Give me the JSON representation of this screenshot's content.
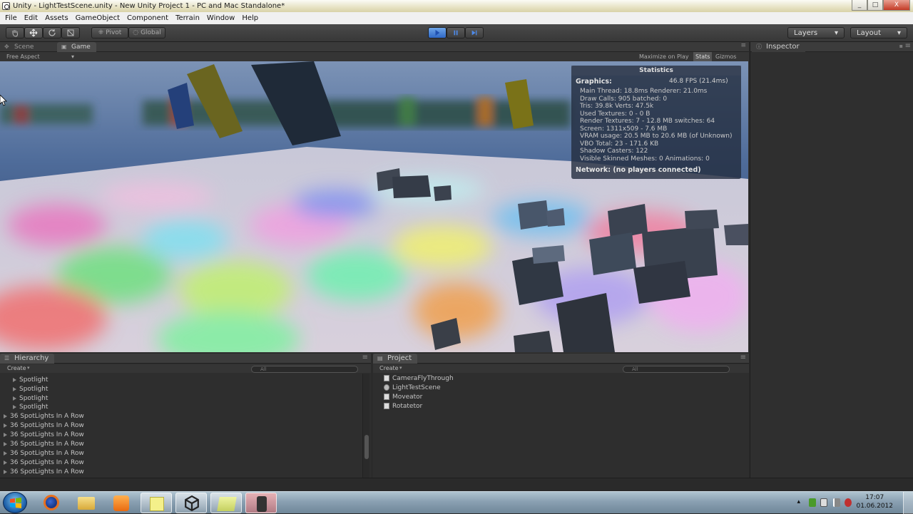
{
  "window": {
    "title": "Unity - LightTestScene.unity - New Unity Project 1 - PC and Mac Standalone*",
    "minimize": "_",
    "maximize": "□",
    "close": "X"
  },
  "menu": [
    "File",
    "Edit",
    "Assets",
    "GameObject",
    "Component",
    "Terrain",
    "Window",
    "Help"
  ],
  "toolbar": {
    "pivot_label": "Pivot",
    "global_label": "Global",
    "layers_label": "Layers",
    "layout_label": "Layout"
  },
  "tabs": {
    "scene": "Scene",
    "game": "Game",
    "inspector": "Inspector",
    "hierarchy": "Hierarchy",
    "project": "Project"
  },
  "game_bar": {
    "aspect": "Free Aspect",
    "maximize_on_play": "Maximize on Play",
    "stats": "Stats",
    "gizmos": "Gizmos"
  },
  "statistics": {
    "title": "Statistics",
    "graphics_label": "Graphics:",
    "fps": "46.8 FPS (21.4ms)",
    "lines": [
      "Main Thread: 18.8ms  Renderer: 21.0ms",
      "Draw Calls: 905   batched: 0",
      "Tris: 39.8k   Verts: 47.5k",
      "Used Textures: 0 - 0 B",
      "Render Textures: 7 - 12.8 MB   switches: 64",
      "Screen: 1311x509 - 7.6 MB",
      "VRAM usage: 20.5 MB to 20.6 MB (of Unknown)",
      "VBO Total: 23 - 171.6 KB",
      "Shadow Casters: 122",
      "Visible Skinned Meshes: 0     Animations: 0"
    ],
    "network": "Network: (no players connected)"
  },
  "hierarchy": {
    "create": "Create",
    "search_placeholder": "All",
    "children": [
      "Spotlight",
      "Spotlight",
      "Spotlight",
      "Spotlight"
    ],
    "groups": [
      "36 SpotLights In A Row",
      "36 SpotLights In A Row",
      "36 SpotLights In A Row",
      "36 SpotLights In A Row",
      "36 SpotLights In A Row",
      "36 SpotLights In A Row",
      "36 SpotLights In A Row"
    ]
  },
  "project": {
    "create": "Create",
    "search_placeholder": "All",
    "items": [
      "CameraFlyThrough",
      "LightTestScene",
      "Moveator",
      "Rotatetor"
    ]
  },
  "taskbar": {
    "time": "17:07",
    "date": "01.06.2012"
  }
}
